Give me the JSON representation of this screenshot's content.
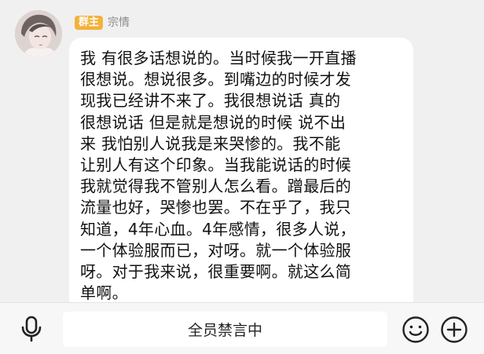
{
  "message": {
    "role_badge": "群主",
    "sender_name": "宗情",
    "text": "我 有很多话想说的。当时候我一开直播\n很想说。想说很多。到嘴边的时候才发\n现我已经讲不来了。我很想说话 真的\n很想说话 但是就是想说的时候 说不出\n来  我怕别人说我是来哭惨的。我不能\n让别人有这个印象。当我能说话的时候\n我就觉得我不管别人怎么看。蹭最后的\n流量也好，哭惨也罢。不在乎了，我只\n知道，4年心血。4年感情，很多人说，\n一个体验服而已，对呀。就一个体验服\n呀。对于我来说，很重要啊。就这么简\n单啊。"
  },
  "input_bar": {
    "muted_label": "全员禁言中",
    "icons": {
      "voice": "microphone-icon",
      "emoji": "emoji-icon",
      "more": "plus-icon"
    }
  },
  "colors": {
    "background": "#f0f0f0",
    "bubble": "#ffffff",
    "role_badge": "#f3b23a",
    "sender_name": "#8a8a8a",
    "text": "#111111"
  }
}
